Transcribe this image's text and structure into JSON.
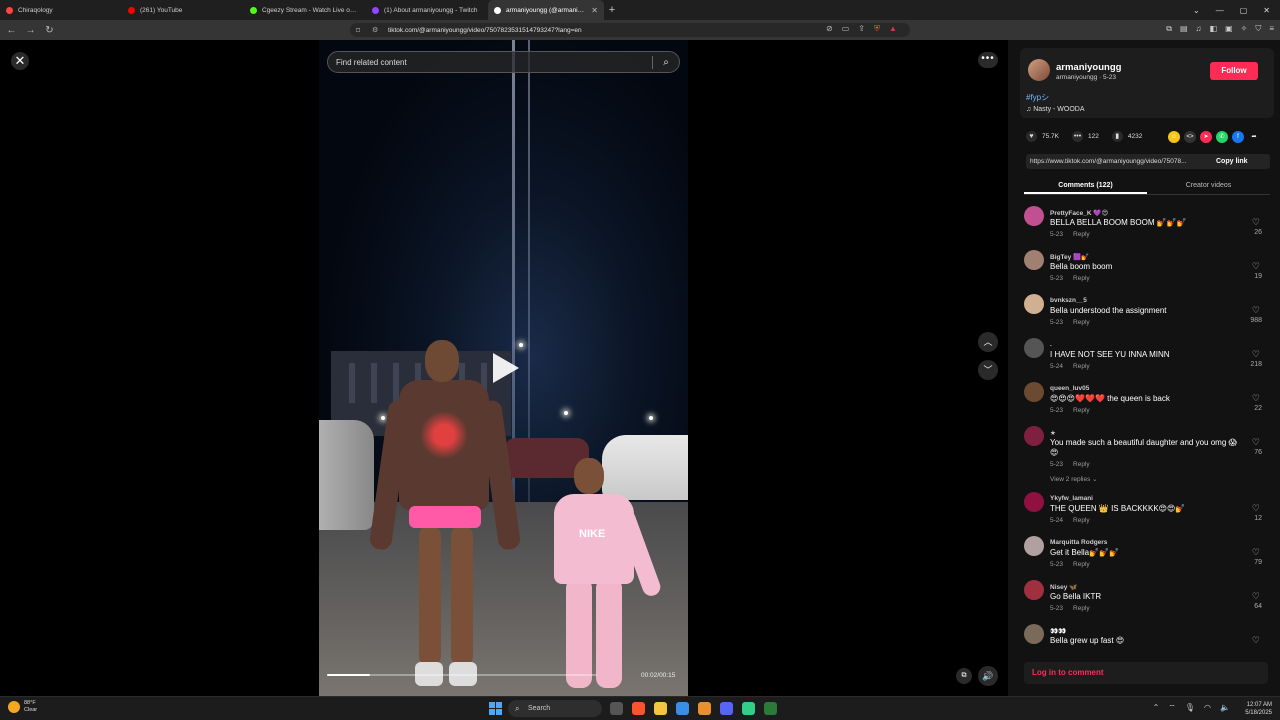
{
  "browser": {
    "tabs": [
      {
        "title": "Chiraqology",
        "color": "#ff4444",
        "active": false
      },
      {
        "title": "(261) YouTube",
        "color": "#ff0000",
        "active": false
      },
      {
        "title": "Cgeezy Stream - Watch Live on Kick",
        "color": "#53fc18",
        "active": false
      },
      {
        "title": "(1) About armaniyoungg - Twitch",
        "color": "#9146ff",
        "active": false
      },
      {
        "title": "armaniyoungg (@armaniyoungg)",
        "color": "#ffffff",
        "active": true
      }
    ],
    "url": "tiktok.com/@armaniyoungg/video/7507823531514793247?lang=en"
  },
  "video": {
    "search_placeholder": "Find related content",
    "timecode": "00:02/00:15",
    "progress": 0.16,
    "shirt_logo": "NIKE"
  },
  "author": {
    "name": "armaniyoungg",
    "sub": "armaniyoungg · 5-23",
    "follow_label": "Follow",
    "hashtag": "#fypシ",
    "music": "♫  Nasty - WOODA"
  },
  "stats": {
    "likes": "75.7K",
    "comments": "122",
    "saves": "4232"
  },
  "link": {
    "url": "https://www.tiktok.com/@armaniyoungg/video/75078...",
    "copy_label": "Copy link"
  },
  "tabs": {
    "comments": "Comments (122)",
    "creator": "Creator videos"
  },
  "comments": [
    {
      "user": "PrettyFace_K 💜😍",
      "text": "BELLA BELLA BOOM BOOM 💅💅💅",
      "date": "5-23",
      "likes": "26",
      "color": "#c05090"
    },
    {
      "user": "BigTey 🟪💅",
      "text": "Bella boom boom",
      "date": "5-23",
      "likes": "19",
      "color": "#a08070"
    },
    {
      "user": "bvnkszn__5",
      "text": "Bella understood the assignment",
      "date": "5-23",
      "likes": "988",
      "color": "#d0b090"
    },
    {
      "user": ".",
      "text": "I HAVE NOT SEE YU INNA MINN",
      "date": "5-24",
      "likes": "218",
      "color": "#555555"
    },
    {
      "user": "queen_luv05",
      "text": "😍😍😍❤️❤️❤️ the queen is back",
      "date": "5-23",
      "likes": "22",
      "color": "#6a4a30"
    },
    {
      "user": "★",
      "text": "You made such a beautiful daughter and you omg 😱😍",
      "date": "5-23",
      "likes": "76",
      "color": "#802040",
      "replies": "View 2 replies ⌄"
    },
    {
      "user": "Ykyfw_lamani",
      "text": "THE QUEEN 👑 IS BACKKKK😍😍💅",
      "date": "5-24",
      "likes": "12",
      "color": "#901040"
    },
    {
      "user": "Marquitta Rodgers",
      "text": "Get it Bella💅💅💅",
      "date": "5-23",
      "likes": "79",
      "color": "#b0a0a0"
    },
    {
      "user": "Nisey 🦋",
      "text": "Go Bella IKTR",
      "date": "5-23",
      "likes": "64",
      "color": "#a03040"
    },
    {
      "user": "👀👀",
      "text": "Bella grew up fast 😍",
      "date": "",
      "likes": "",
      "color": "#7a6a5a"
    }
  ],
  "reply_label": "Reply",
  "login_label": "Log in to comment",
  "taskbar": {
    "temp": "88°F",
    "weather": "Clear",
    "search": "Search",
    "time": "12:07 AM",
    "date": "5/18/2025"
  }
}
